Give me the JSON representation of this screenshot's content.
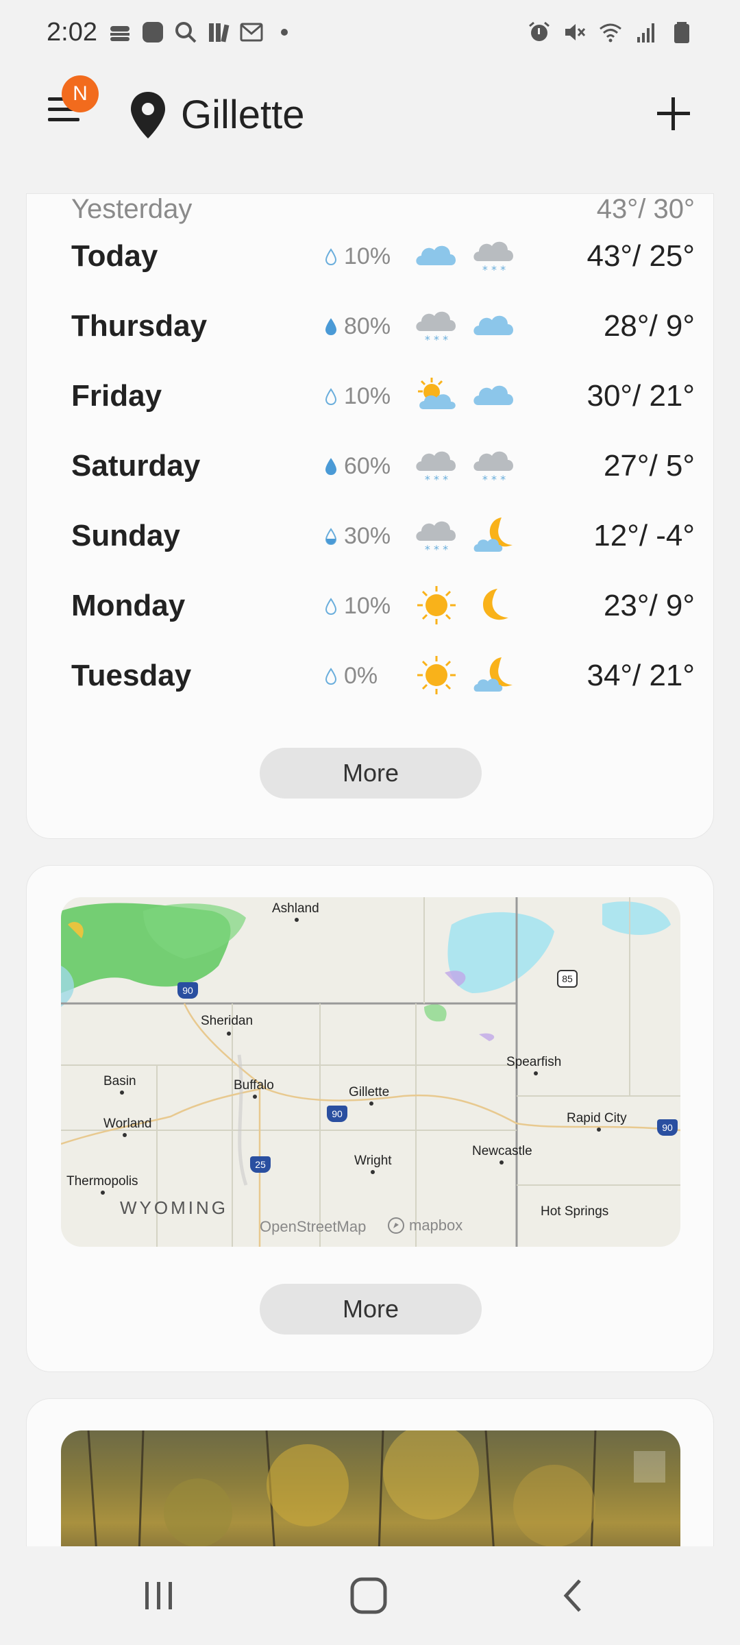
{
  "status_bar": {
    "time": "2:02"
  },
  "header": {
    "location": "Gillette",
    "notification_badge": "N"
  },
  "forecast": {
    "yesterday": {
      "label": "Yesterday",
      "temps": "43°/ 30°"
    },
    "days": [
      {
        "day": "Today",
        "precip": "10%",
        "drop": "empty",
        "icon1": "cloud-icon",
        "icon2": "snow-icon",
        "temps": "43°/ 25°"
      },
      {
        "day": "Thursday",
        "precip": "80%",
        "drop": "full",
        "icon1": "snow-icon",
        "icon2": "cloud-icon",
        "temps": "28°/ 9°"
      },
      {
        "day": "Friday",
        "precip": "10%",
        "drop": "empty",
        "icon1": "partly-sunny-icon",
        "icon2": "cloud-icon",
        "temps": "30°/ 21°"
      },
      {
        "day": "Saturday",
        "precip": "60%",
        "drop": "full",
        "icon1": "snow-icon",
        "icon2": "snow-icon",
        "temps": "27°/ 5°"
      },
      {
        "day": "Sunday",
        "precip": "30%",
        "drop": "half",
        "icon1": "snow-icon",
        "icon2": "partly-cloudy-night-icon",
        "temps": "12°/ -4°"
      },
      {
        "day": "Monday",
        "precip": "10%",
        "drop": "empty",
        "icon1": "sun-icon",
        "icon2": "moon-icon",
        "temps": "23°/ 9°"
      },
      {
        "day": "Tuesday",
        "precip": "0%",
        "drop": "empty",
        "icon1": "sun-icon",
        "icon2": "partly-cloudy-night-icon",
        "temps": "34°/ 21°"
      }
    ],
    "more_label": "More"
  },
  "map": {
    "places": [
      "Ashland",
      "Sheridan",
      "Spearfish",
      "Basin",
      "Buffalo",
      "Gillette",
      "Rapid City",
      "Worland",
      "Newcastle",
      "Wright",
      "Thermopolis",
      "Hot Springs"
    ],
    "state_label": "WYOMING",
    "highway_labels": [
      "90",
      "85",
      "90",
      "25",
      "90"
    ],
    "attribution": [
      "OpenStreetMap",
      "mapbox"
    ],
    "more_label": "More"
  },
  "colors": {
    "accent": "#f26b1d",
    "cloud": "#8cc6ea",
    "snow_cloud": "#b8bcc0",
    "sun": "#f9b21a"
  }
}
